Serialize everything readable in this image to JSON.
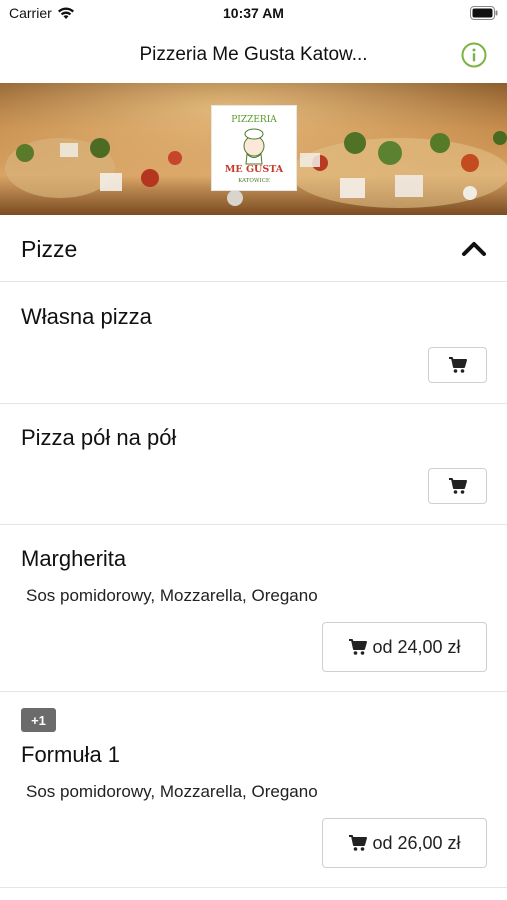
{
  "status_bar": {
    "carrier": "Carrier",
    "time": "10:37 AM"
  },
  "nav": {
    "title": "Pizzeria Me Gusta Katow...",
    "info_icon": "info-icon",
    "accent": "#7cb342"
  },
  "logo": {
    "line1": "PIZZERIA",
    "line2": "ME GUSTA",
    "line3": "KATOWICE"
  },
  "section": {
    "title": "Pizze",
    "expanded": true
  },
  "items": [
    {
      "name": "Własna pizza",
      "description": "",
      "button_label": ""
    },
    {
      "name": "Pizza pół na pół",
      "description": "",
      "button_label": ""
    },
    {
      "name": "Margherita",
      "description": "Sos pomidorowy, Mozzarella, Oregano",
      "button_label": "od 24,00 zł"
    },
    {
      "name": "Formuła 1",
      "badge": "+1",
      "description": "Sos pomidorowy, Mozzarella, Oregano",
      "button_label": "od 26,00 zł"
    }
  ]
}
